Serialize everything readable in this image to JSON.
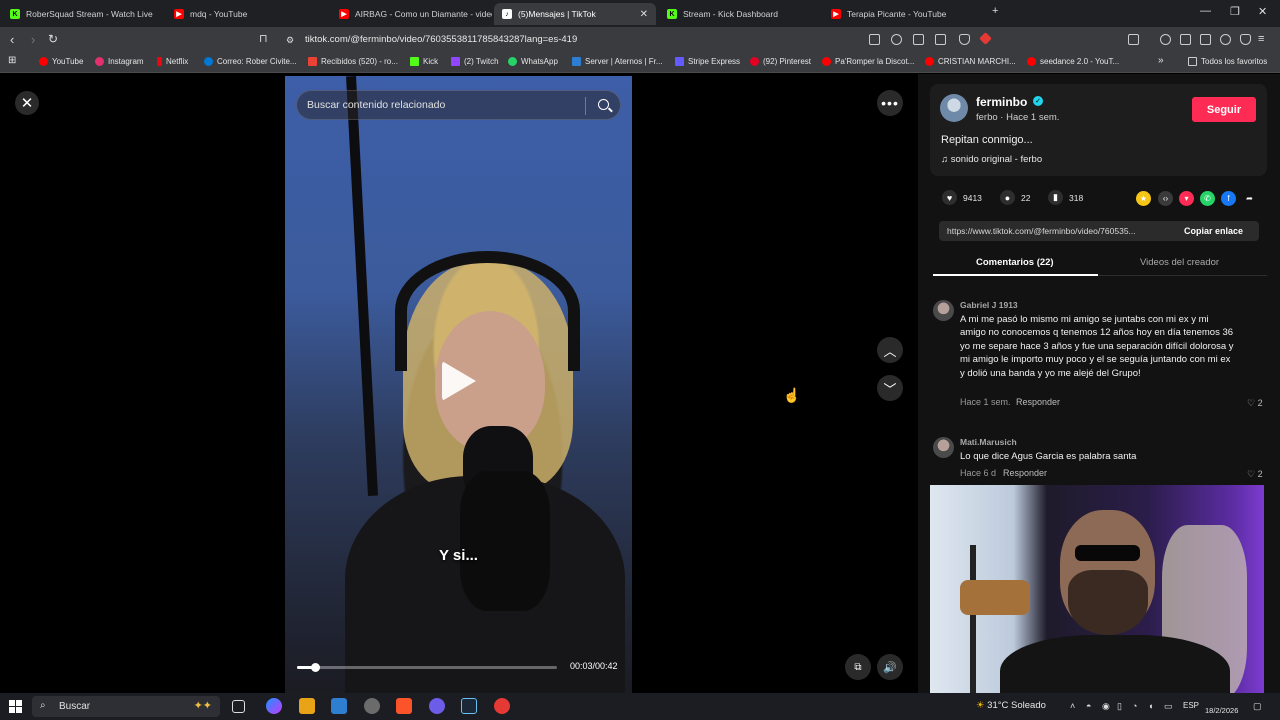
{
  "browser": {
    "tabs": [
      {
        "label": "RoberSquad Stream - Watch Live",
        "color": "#53fc18"
      },
      {
        "label": "mdq - YouTube",
        "color": "#ff0000"
      },
      {
        "label": "AIRBAG - Como un Diamante - video",
        "color": "#ff0000"
      },
      {
        "label": "(5)Mensajes | TikTok",
        "color": "#ffffff"
      },
      {
        "label": "Stream - Kick Dashboard",
        "color": "#53fc18"
      },
      {
        "label": "Terapia Picante - YouTube",
        "color": "#ff0000"
      }
    ],
    "url": "tiktok.com/@ferminbo/video/7603553811785843287lang=es-419",
    "bookmarks": [
      {
        "label": "YouTube",
        "color": "#ff0000"
      },
      {
        "label": "Instagram",
        "color": "#e1306c"
      },
      {
        "label": "Netflix",
        "color": "#e50914"
      },
      {
        "label": "Correo: Rober Civite...",
        "color": "#0078d4"
      },
      {
        "label": "Recibidos (520) - ro...",
        "color": "#ea4335"
      },
      {
        "label": "Kick",
        "color": "#53fc18"
      },
      {
        "label": "(2) Twitch",
        "color": "#9146ff"
      },
      {
        "label": "WhatsApp",
        "color": "#25d366"
      },
      {
        "label": "Server | Aternos | Fr...",
        "color": "#2d7dd2"
      },
      {
        "label": "Stripe Express",
        "color": "#635bff"
      },
      {
        "label": "(92) Pinterest",
        "color": "#e60023"
      },
      {
        "label": "Pa'Romper la Discot...",
        "color": "#ff0000"
      },
      {
        "label": "CRISTIAN MARCHI...",
        "color": "#ff0000"
      },
      {
        "label": "seedance 2.0 - YouT...",
        "color": "#ff0000"
      }
    ],
    "all_favorites": "Todos los favoritos"
  },
  "video": {
    "search_placeholder": "Buscar contenido relacionado",
    "caption": "Y si...",
    "time": "00:03/00:42",
    "progress": 0.07
  },
  "creator": {
    "username": "ferminbo",
    "meta": "ferbo · Hace 1 sem.",
    "follow_label": "Seguir",
    "description": "Repitan conmigo...",
    "sound": "sonido original - ferbo",
    "likes": "9413",
    "comments": "22",
    "saves": "318",
    "link": "https://www.tiktok.com/@ferminbo/video/760535...",
    "copy_label": "Copiar enlace",
    "share_colors": [
      "#f5c518",
      "#3a3a3a",
      "#fe2c55",
      "#25d366",
      "#1877f2",
      "#121212"
    ]
  },
  "tabs": {
    "comments": "Comentarios (22)",
    "creator_videos": "Videos del creador"
  },
  "comments": [
    {
      "user": "Gabriel J 1913",
      "text": "A mi me pasó lo mismo mi amigo se juntabs con mi ex y mi amigo no conocemos q tenemos 12 años hoy en día tenemos 36 yo me separe hace 3 años y fue una separación difícil dolorosa y mi amigo le importo muy poco y el se seguía juntando con mi ex y dolió una banda y yo me alejé del Grupo!",
      "time": "Hace 1 sem.",
      "reply": "Responder",
      "likes": "2"
    },
    {
      "user": "Mati.Marusich",
      "text": "Lo que dice Agus Garcia es palabra santa",
      "time": "Hace 6 d",
      "reply": "Responder",
      "likes": "2"
    }
  ],
  "taskbar": {
    "search": "Buscar",
    "weather": "31°C  Soleado",
    "lang": "ESP",
    "date": "18/2/2026",
    "apps": [
      "#1e90ff",
      "#e8a317",
      "#2f7fd1",
      "#6b6b6b",
      "#fb542b",
      "#6c5ce7",
      "#1b2838",
      "#e53935"
    ]
  }
}
